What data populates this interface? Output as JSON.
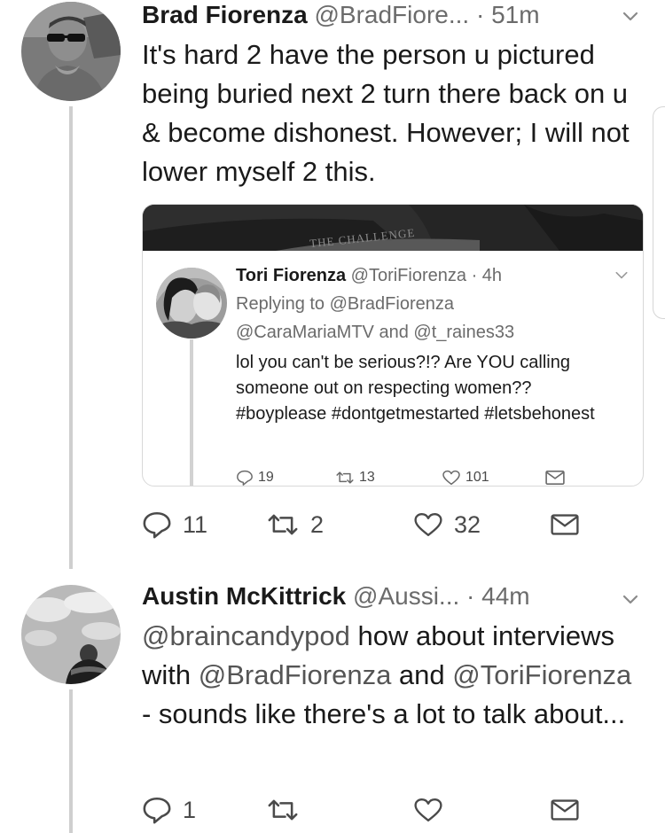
{
  "tweets": [
    {
      "name": "Brad Fiorenza",
      "handle": "@BradFiore...",
      "time": "· 51m",
      "text": "It's hard 2 have the person u pictured being buried next 2 turn there back on u & become dishonest. However; I will not lower myself 2 this.",
      "stats": {
        "replies": "11",
        "retweets": "2",
        "likes": "32"
      }
    },
    {
      "name": "Austin McKittrick",
      "handle": "@Aussi...",
      "time": "· 44m",
      "text_parts": [
        {
          "t": "@braincandypod",
          "mention": true
        },
        {
          "t": " how about interviews with ",
          "mention": false
        },
        {
          "t": "@BradFiorenza",
          "mention": true
        },
        {
          "t": " and ",
          "mention": false
        },
        {
          "t": "@ToriFiorenza",
          "mention": true
        },
        {
          "t": " - sounds like there's a lot to talk about...",
          "mention": false
        }
      ],
      "stats": {
        "replies": "1",
        "retweets": "",
        "likes": ""
      }
    }
  ],
  "quoted": {
    "banner_text": "THE CHALLENGE",
    "name": "Tori Fiorenza",
    "handle": "@ToriFiorenza",
    "time": "· 4h",
    "replying_prefix": "Replying to",
    "replying_to_1": "@BradFiorenza",
    "replying_to_2": "@CaraMariaMTV",
    "replying_and": "and",
    "replying_to_3": "@t_raines33",
    "text": "lol you can't be serious?!? Are YOU calling someone out on respecting women?? #boyplease #dontgetmestarted #letsbehonest",
    "stats": {
      "replies": "19",
      "retweets": "13",
      "likes": "101"
    }
  },
  "colors": {
    "text": "#1a1a1a",
    "secondary": "#6b6b6b",
    "line": "#cfcfcf"
  }
}
